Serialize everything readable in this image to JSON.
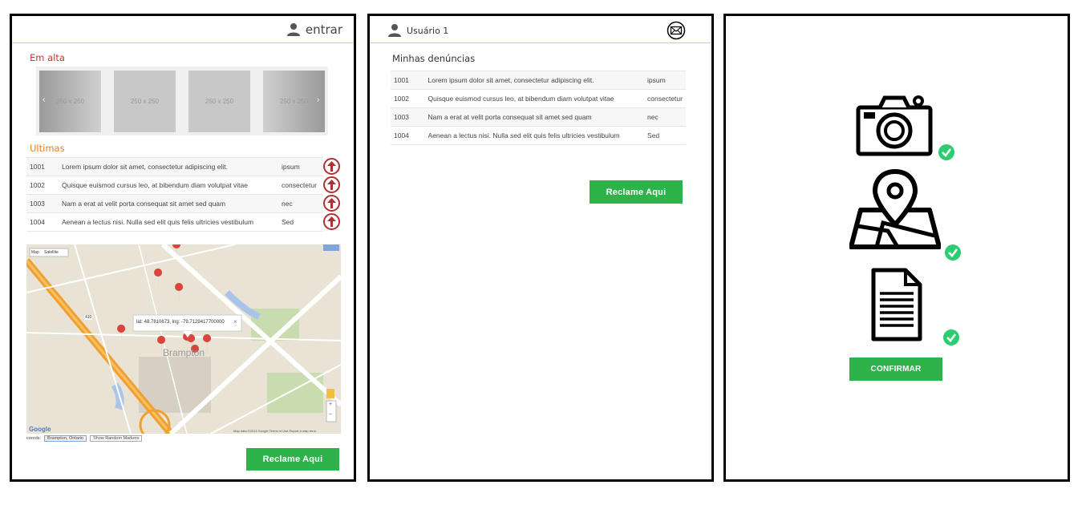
{
  "panel1": {
    "login_label": "entrar",
    "trending_title": "Em alta",
    "carousel_slides": [
      "250 x 250",
      "250 x 250",
      "250 x 250",
      "250 x 250"
    ],
    "carousel_prev": "‹",
    "carousel_next": "›",
    "latest_title": "Ultimas",
    "rows": [
      {
        "id": "1001",
        "text": "Lorem ipsum dolor sit amet, consectetur adipiscing elit.",
        "tag": "ipsum"
      },
      {
        "id": "1002",
        "text": "Quisque euismod cursus leo, at bibendum diam volutpat vitae",
        "tag": "consectetur"
      },
      {
        "id": "1003",
        "text": "Nam a erat at velit porta consequat sit amet sed quam",
        "tag": "nec"
      },
      {
        "id": "1004",
        "text": "Aenean a lectus nisi. Nulla sed elit quis felis ultricies vestibulum",
        "tag": "Sed"
      }
    ],
    "map": {
      "type_buttons": [
        "Map",
        "Satellite"
      ],
      "popup_text": "lat: 48.7810673, lng: -79.7129417700000",
      "popup_close": "×",
      "place_label": "Brampton",
      "google_logo": "Google",
      "attribution": "Map data ©2015 Google   Terms of Use   Report a map error",
      "highway_shield": "410",
      "zoom_in": "+",
      "zoom_out": "−"
    },
    "coords_label": "coords:",
    "coords_value": "Brampton, Ontario",
    "coords_button": "Show Random Markers",
    "cta_label": "Reclame Aqui"
  },
  "panel2": {
    "user_label": "Usuário 1",
    "section_title": "Minhas denúncias",
    "rows": [
      {
        "id": "1001",
        "text": "Lorem ipsum dolor sit amet, consectetur adipiscing elit.",
        "tag": "ipsum"
      },
      {
        "id": "1002",
        "text": "Quisque euismod cursus leo, at bibendum diam volutpat vitae",
        "tag": "consectetur"
      },
      {
        "id": "1003",
        "text": "Nam a erat at velit porta consequat sit amet sed quam",
        "tag": "nec"
      },
      {
        "id": "1004",
        "text": "Aenean a lectus nisi. Nulla sed elit quis felis ultricies vestibulum",
        "tag": "Sed"
      }
    ],
    "cta_label": "Reclame Aqui"
  },
  "panel3": {
    "confirm_label": "CONFIRMAR"
  },
  "colors": {
    "accent_green": "#2db34a",
    "header_rule": "#e0d25a",
    "arrow_red": "#b03030",
    "check_green": "#2ecc71"
  },
  "icons": [
    "user-icon",
    "mail-icon",
    "up-arrow-icon",
    "camera-icon",
    "map-pin-icon",
    "document-icon",
    "check-icon"
  ]
}
